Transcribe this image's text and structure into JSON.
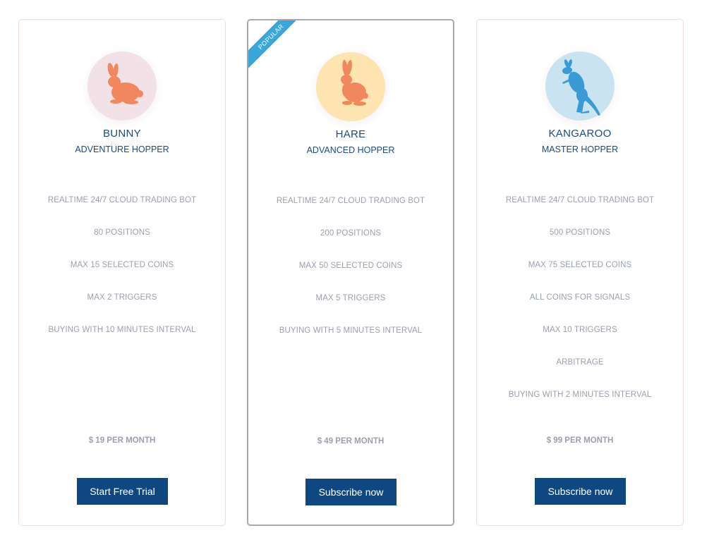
{
  "colors": {
    "brand_blue": "#0f4880",
    "title_blue": "#1a4b82",
    "feature_gray": "#9aa0ad",
    "ribbon_blue": "#3aa6da",
    "bunny_circle": "#f2e2e7",
    "hare_circle": "#fde4b0",
    "kangaroo_circle": "#c9e3f0",
    "rabbit_orange": "#f0875e",
    "kangaroo_blue": "#3a9ad5"
  },
  "plans": [
    {
      "name": "BUNNY",
      "subtitle": "ADVENTURE HOPPER",
      "icon": "rabbit-icon",
      "features": [
        "REALTIME 24/7 CLOUD TRADING BOT",
        "80 POSITIONS",
        "MAX 15 SELECTED COINS",
        "MAX 2 TRIGGERS",
        "BUYING WITH 10 MINUTES INTERVAL"
      ],
      "price": "$ 19 PER MONTH",
      "button": "Start Free Trial"
    },
    {
      "name": "HARE",
      "subtitle": "ADVANCED HOPPER",
      "badge": "POPULAR",
      "icon": "hare-icon",
      "features": [
        "REALTIME 24/7 CLOUD TRADING BOT",
        "200 POSITIONS",
        "MAX 50 SELECTED COINS",
        "MAX 5 TRIGGERS",
        "BUYING WITH 5 MINUTES INTERVAL"
      ],
      "price": "$ 49 PER MONTH",
      "button": "Subscribe now"
    },
    {
      "name": "KANGAROO",
      "subtitle": "MASTER HOPPER",
      "icon": "kangaroo-icon",
      "features": [
        "REALTIME 24/7 CLOUD TRADING BOT",
        "500 POSITIONS",
        "MAX 75 SELECTED COINS",
        "ALL COINS FOR SIGNALS",
        "MAX 10 TRIGGERS",
        "ARBITRAGE",
        "BUYING WITH 2 MINUTES INTERVAL"
      ],
      "price": "$ 99 PER MONTH",
      "button": "Subscribe now"
    }
  ]
}
